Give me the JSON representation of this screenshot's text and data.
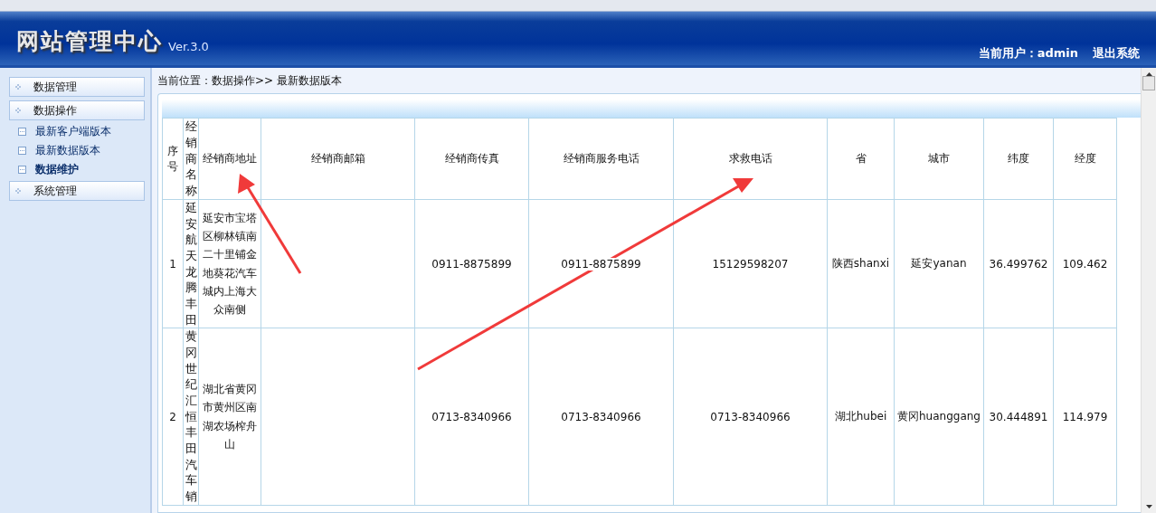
{
  "header": {
    "title": "网站管理中心",
    "version": "Ver.3.0",
    "user": "当前用户：admin",
    "logout": "退出系统"
  },
  "sidebar": {
    "groups": [
      {
        "label": "数据管理"
      },
      {
        "label": "数据操作",
        "children": [
          {
            "label": "最新客户端版本",
            "selected": false
          },
          {
            "label": "最新数据版本",
            "selected": false
          },
          {
            "label": "数据维护",
            "selected": true
          }
        ]
      },
      {
        "label": "系统管理"
      }
    ]
  },
  "breadcrumb": "当前位置：数据操作>> 最新数据版本",
  "table": {
    "columns": [
      "序号",
      "经销商名称",
      "经销商地址",
      "经销商邮箱",
      "经销商传真",
      "经销商服务电话",
      "求救电话",
      "省",
      "城市",
      "纬度",
      "经度"
    ],
    "rows": [
      [
        "1",
        "延安航天龙腾丰田",
        "延安市宝塔区柳林镇南二十里铺金地葵花汽车城内上海大众南侧",
        "",
        "0911-8875899",
        "0911-8875899",
        "15129598207",
        "陕西shanxi",
        "延安yanan",
        "36.499762",
        "109.462"
      ],
      [
        "2",
        "黄冈世纪汇恒丰田汽车销",
        "湖北省黄冈市黄州区南湖农场榨舟山",
        "",
        "0713-8340966",
        "0713-8340966",
        "0713-8340966",
        "湖北hubei",
        "黄冈huanggang",
        "30.444891",
        "114.979"
      ]
    ]
  }
}
